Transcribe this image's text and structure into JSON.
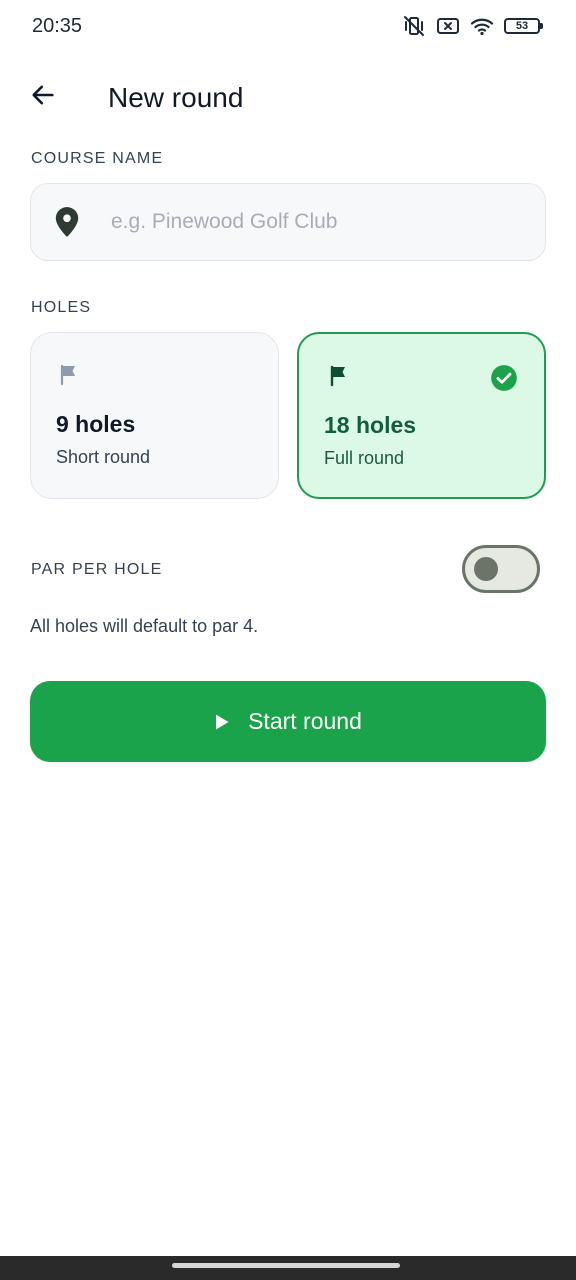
{
  "status_bar": {
    "time": "20:35",
    "battery_level": "53",
    "icons": [
      "vibrate-off-icon",
      "no-sim-icon",
      "wifi-icon",
      "battery-icon"
    ]
  },
  "header": {
    "title": "New round",
    "back_icon": "arrow-left-icon"
  },
  "course": {
    "section_label": "COURSE NAME",
    "placeholder": "e.g. Pinewood Golf Club",
    "value": "",
    "icon": "location-pin-icon"
  },
  "holes": {
    "section_label": "HOLES",
    "options": [
      {
        "title": "9 holes",
        "subtitle": "Short round",
        "selected": false,
        "icon": "flag-icon"
      },
      {
        "title": "18 holes",
        "subtitle": "Full round",
        "selected": true,
        "icon": "flag-icon"
      }
    ]
  },
  "par": {
    "section_label": "PAR PER HOLE",
    "toggle_on": false,
    "note": "All holes will default to par 4."
  },
  "start_button": {
    "label": "Start round",
    "icon": "play-icon"
  },
  "colors": {
    "accent": "#1aa34a",
    "selected_card_bg": "#dcf9e5",
    "selected_card_border": "#1f9d4f",
    "selected_text": "#125e3a"
  }
}
